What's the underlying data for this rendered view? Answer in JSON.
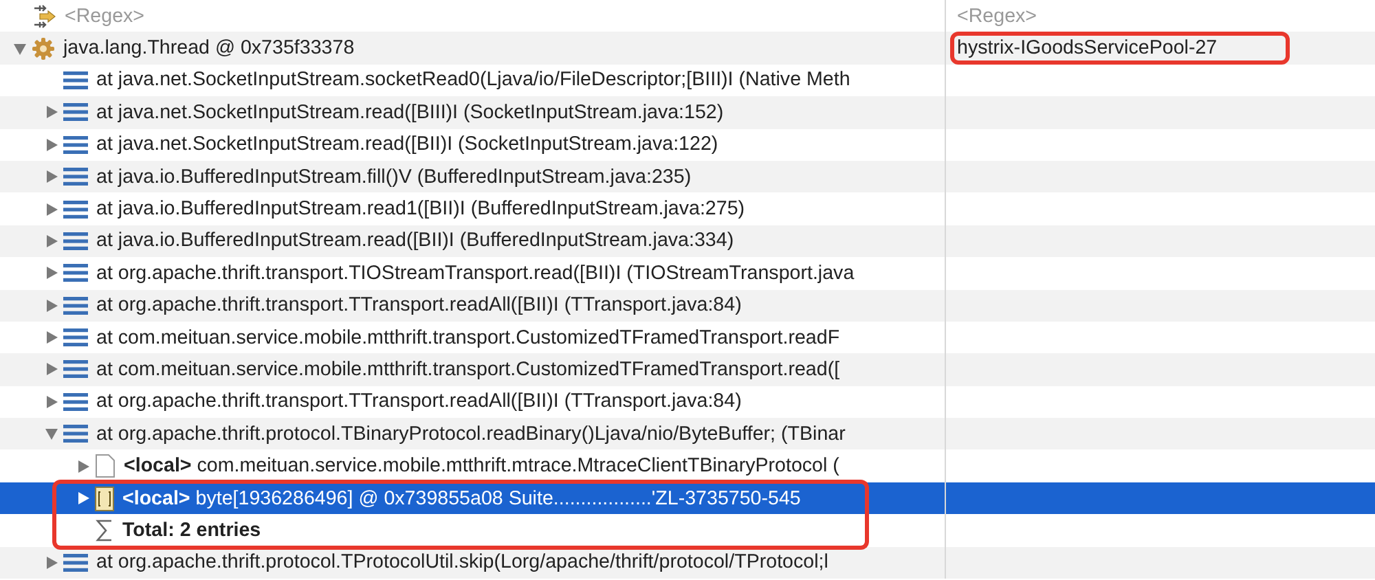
{
  "rows": [
    {
      "kind": "regex",
      "label": "<Regex>",
      "value": "<Regex>",
      "selected": false,
      "outlined": false,
      "value_outlined": false
    },
    {
      "kind": "thread",
      "label": "java.lang.Thread @ 0x735f33378",
      "value": "hystrix-IGoodsServicePool-27",
      "expanded": true,
      "selected": false,
      "outlined": false,
      "value_outlined": true,
      "children": [
        {
          "kind": "frame",
          "label": "at java.net.SocketInputStream.socketRead0(Ljava/io/FileDescriptor;[BIII)I (Native Meth",
          "selected": false,
          "outlined": false
        },
        {
          "kind": "frame",
          "label": "at java.net.SocketInputStream.read([BIII)I (SocketInputStream.java:152)",
          "expanded": false,
          "selected": false,
          "outlined": false
        },
        {
          "kind": "frame",
          "label": "at java.net.SocketInputStream.read([BII)I (SocketInputStream.java:122)",
          "expanded": false,
          "selected": false,
          "outlined": false
        },
        {
          "kind": "frame",
          "label": "at java.io.BufferedInputStream.fill()V (BufferedInputStream.java:235)",
          "expanded": false,
          "selected": false,
          "outlined": false
        },
        {
          "kind": "frame",
          "label": "at java.io.BufferedInputStream.read1([BII)I (BufferedInputStream.java:275)",
          "expanded": false,
          "selected": false,
          "outlined": false
        },
        {
          "kind": "frame",
          "label": "at java.io.BufferedInputStream.read([BII)I (BufferedInputStream.java:334)",
          "expanded": false,
          "selected": false,
          "outlined": false
        },
        {
          "kind": "frame",
          "label": "at org.apache.thrift.transport.TIOStreamTransport.read([BII)I (TIOStreamTransport.java",
          "expanded": false,
          "selected": false,
          "outlined": false
        },
        {
          "kind": "frame",
          "label": "at org.apache.thrift.transport.TTransport.readAll([BII)I (TTransport.java:84)",
          "expanded": false,
          "selected": false,
          "outlined": false
        },
        {
          "kind": "frame",
          "label": "at com.meituan.service.mobile.mtthrift.transport.CustomizedTFramedTransport.readF",
          "expanded": false,
          "selected": false,
          "outlined": false
        },
        {
          "kind": "frame",
          "label": "at com.meituan.service.mobile.mtthrift.transport.CustomizedTFramedTransport.read([",
          "expanded": false,
          "selected": false,
          "outlined": false
        },
        {
          "kind": "frame",
          "label": "at org.apache.thrift.transport.TTransport.readAll([BII)I (TTransport.java:84)",
          "expanded": false,
          "selected": false,
          "outlined": false
        },
        {
          "kind": "frame",
          "label": "at org.apache.thrift.protocol.TBinaryProtocol.readBinary()Ljava/nio/ByteBuffer; (TBinar",
          "expanded": true,
          "selected": false,
          "outlined": false,
          "children": [
            {
              "kind": "object",
              "label": "**<local>** com.meituan.service.mobile.mtthrift.mtrace.MtraceClientTBinaryProtocol (",
              "expanded": false,
              "selected": false,
              "outlined": false
            },
            {
              "kind": "array",
              "label": "**<local>** byte[1936286496] @ 0x739855a08  Suite..................'ZL-3735750-545",
              "expanded": false,
              "selected": true,
              "outlined": true
            },
            {
              "kind": "total",
              "label": "Total: 2 entries",
              "selected": false,
              "outlined": true
            }
          ]
        },
        {
          "kind": "frame",
          "label": "at org.apache.thrift.protocol.TProtocolUtil.skip(Lorg/apache/thrift/protocol/TProtocol;l",
          "expanded": false,
          "selected": false,
          "outlined": false
        }
      ]
    }
  ]
}
